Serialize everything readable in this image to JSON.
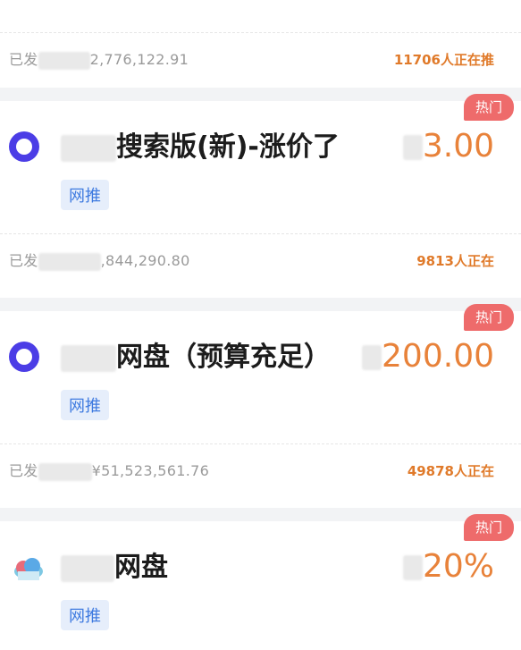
{
  "cards": [
    {
      "sent": "已发",
      "amount": "2,776,122.91",
      "people": "11706人正在推"
    },
    {
      "hot": "热门",
      "title": "搜索版(新)-涨价了",
      "price": "3.00",
      "tag": "网推",
      "sent": "已发",
      "amount": ",844,290.80",
      "people": "9813人正在"
    },
    {
      "hot": "热门",
      "title": "网盘（预算充足）",
      "price": "200.00",
      "tag": "网推",
      "sent": "已发",
      "amount": "¥51,523,561.76",
      "people": "49878人正在"
    },
    {
      "hot": "热门",
      "title": "网盘",
      "price": "20%",
      "tag": "网推"
    }
  ],
  "colors": {
    "price": "#e8823a",
    "hot": "#ee6b6b",
    "tag_bg": "#e6eefb",
    "tag_fg": "#3f7be0",
    "logo": "#4b3de6"
  }
}
